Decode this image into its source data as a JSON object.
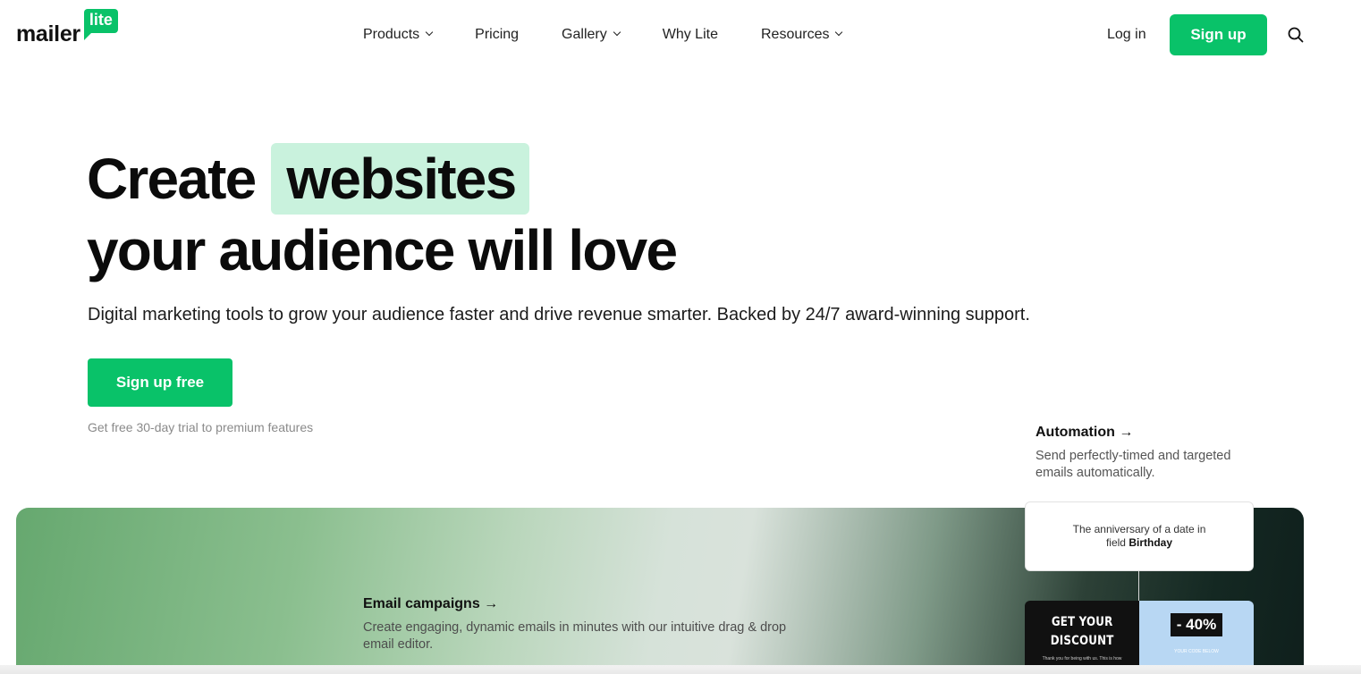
{
  "brand": {
    "word": "mailer",
    "badge": "lite",
    "accent": "#09c269"
  },
  "nav": {
    "items": [
      {
        "label": "Products",
        "dropdown": true
      },
      {
        "label": "Pricing",
        "dropdown": false
      },
      {
        "label": "Gallery",
        "dropdown": true
      },
      {
        "label": "Why Lite",
        "dropdown": false
      },
      {
        "label": "Resources",
        "dropdown": true
      }
    ],
    "login": "Log in",
    "signup": "Sign up",
    "search_icon": "search-icon"
  },
  "hero": {
    "title_word": "Create",
    "title_highlight": "websites",
    "title_line2": "your audience will love",
    "subtitle": "Digital marketing tools to grow your audience faster and drive revenue smarter. Backed by 24/7 award-winning support.",
    "cta": "Sign up free",
    "trial_note": "Get free 30-day trial to premium features",
    "highlight_color": "#c9f2dd"
  },
  "features": {
    "email": {
      "title": "Email campaigns →",
      "desc": "Create engaging, dynamic emails in minutes with our intuitive drag & drop email editor."
    },
    "automation": {
      "title": "Automation →",
      "desc": "Send perfectly-timed and targeted emails automatically."
    }
  },
  "automation_card": {
    "line1": "The anniversary of a date in",
    "line2_prefix": "field",
    "line2_field": "Birthday"
  },
  "promo": {
    "left_title_1": "GET YOUR",
    "left_title_2": "DISCOUNT",
    "left_small": "Thank you for being with us. This is how",
    "discount": "- 40%",
    "right_small": "YOUR CODE BELOW"
  }
}
